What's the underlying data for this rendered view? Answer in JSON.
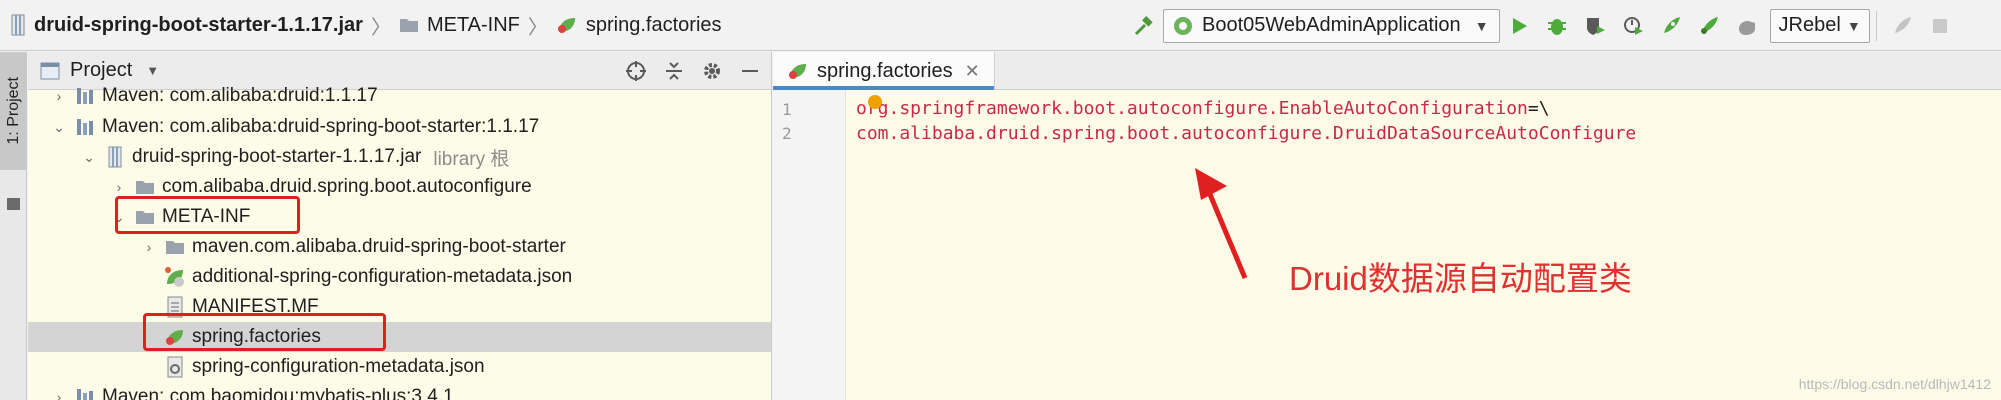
{
  "breadcrumb": {
    "items": [
      {
        "label": "druid-spring-boot-starter-1.1.17.jar",
        "icon": "jar-icon"
      },
      {
        "label": "META-INF",
        "icon": "folder-icon"
      },
      {
        "label": "spring.factories",
        "icon": "spring-file-icon"
      }
    ]
  },
  "toolbar": {
    "run_config": "Boot05WebAdminApplication",
    "jrebel": "JRebel"
  },
  "stripe": {
    "project_tab": "1: Project"
  },
  "project_panel": {
    "title": "Project",
    "tree": [
      {
        "label": "Maven: com.alibaba:druid:1.1.17",
        "chevron": "›",
        "level": 1
      },
      {
        "label": "Maven: com.alibaba:druid-spring-boot-starter:1.1.17",
        "chevron": "⌄",
        "level": 1
      },
      {
        "label": "druid-spring-boot-starter-1.1.17.jar",
        "hint": "library 根",
        "chevron": "⌄",
        "level": 2
      },
      {
        "label": "com.alibaba.druid.spring.boot.autoconfigure",
        "chevron": "›",
        "level": 3
      },
      {
        "label": "META-INF",
        "chevron": "⌄",
        "level": 3
      },
      {
        "label": "maven.com.alibaba.druid-spring-boot-starter",
        "chevron": "›",
        "level": 4
      },
      {
        "label": "additional-spring-configuration-metadata.json",
        "level": 4
      },
      {
        "label": "MANIFEST.MF",
        "level": 4
      },
      {
        "label": "spring.factories",
        "level": 4,
        "selected": true
      },
      {
        "label": "spring-configuration-metadata.json",
        "level": 4
      },
      {
        "label": "Maven: com.baomidou:mybatis-plus:3.4.1",
        "chevron": "›",
        "level": 1
      }
    ]
  },
  "editor": {
    "tab_label": "spring.factories",
    "lines": [
      {
        "num": "1",
        "key": "org.springframework.boot.autoconfigure.EnableAutoConfiguration",
        "op": "=\\"
      },
      {
        "num": "2",
        "value": "com.alibaba.druid.spring.boot.autoconfigure.DruidDataSourceAutoConfigure"
      }
    ]
  },
  "annotation": "Druid数据源自动配置类",
  "watermark": "https://blog.csdn.net/dlhjw1412",
  "colors": {
    "accent": "#4a88c7",
    "highlight": "#e02020",
    "key": "#c8284a"
  }
}
